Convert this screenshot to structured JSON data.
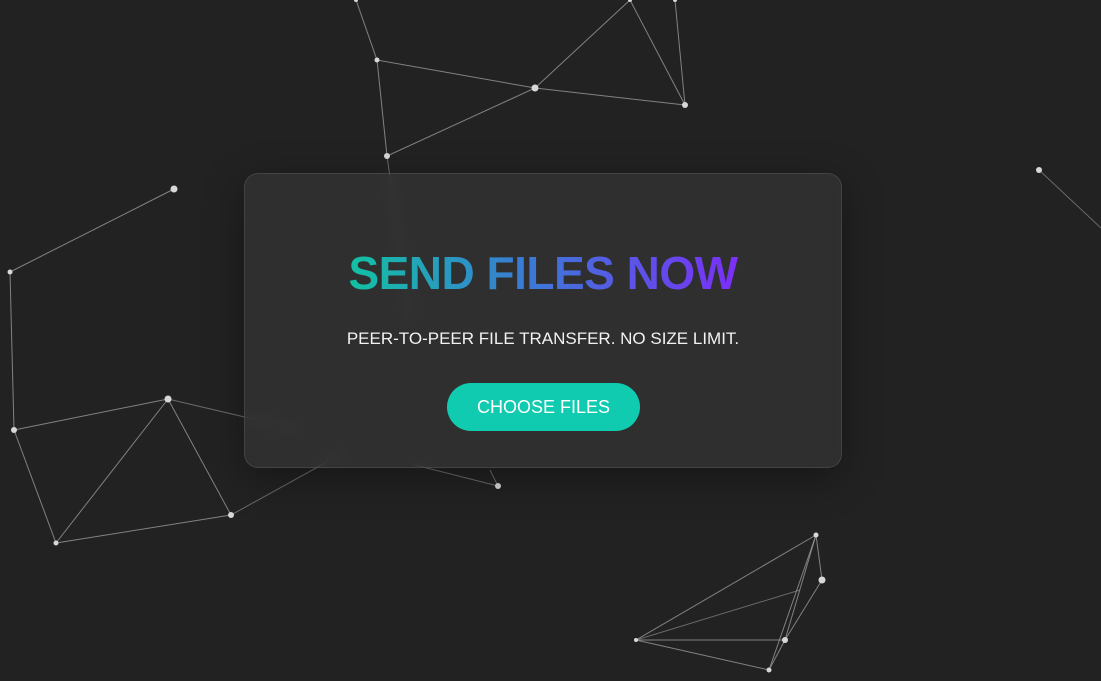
{
  "hero": {
    "title": "SEND FILES NOW",
    "subtitle": "PEER-TO-PEER FILE TRANSFER. NO SIZE LIMIT.",
    "cta_label": "CHOOSE FILES"
  },
  "colors": {
    "background": "#222222",
    "accent": "#11cbb0",
    "title_gradient_start": "#12c2a3",
    "title_gradient_end": "#7b2ff7",
    "network_line": "#9a9a9a",
    "network_node": "#d8d8d8"
  }
}
